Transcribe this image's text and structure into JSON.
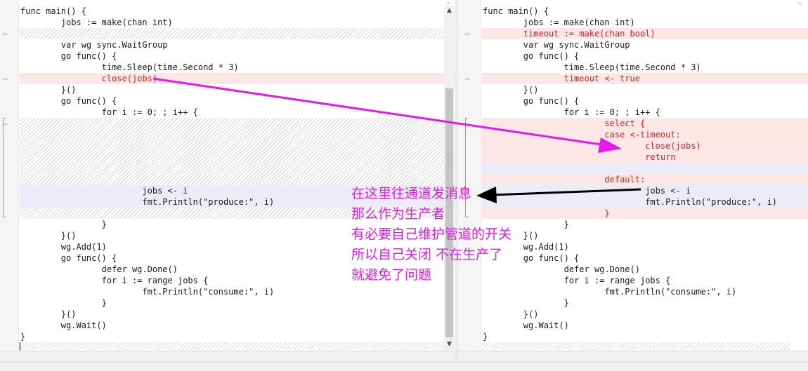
{
  "left": {
    "lines": [
      {
        "text": "func main() {",
        "type": "normal"
      },
      {
        "text": "        jobs := make(chan int)",
        "type": "normal"
      },
      {
        "text": "",
        "type": "filler"
      },
      {
        "text": "        var wg sync.WaitGroup",
        "type": "normal"
      },
      {
        "text": "        go func() {",
        "type": "normal"
      },
      {
        "text": "                time.Sleep(time.Second * 3)",
        "type": "normal"
      },
      {
        "text": "                close(jobs)",
        "type": "removed"
      },
      {
        "text": "        }()",
        "type": "normal"
      },
      {
        "text": "        go func() {",
        "type": "normal"
      },
      {
        "text": "                for i := 0; ; i++ {",
        "type": "normal"
      },
      {
        "text": "",
        "type": "filler"
      },
      {
        "text": "",
        "type": "filler"
      },
      {
        "text": "",
        "type": "filler"
      },
      {
        "text": "",
        "type": "filler"
      },
      {
        "text": "",
        "type": "filler"
      },
      {
        "text": "",
        "type": "filler"
      },
      {
        "text": "                        jobs <- i",
        "type": "changed"
      },
      {
        "text": "                        fmt.Println(\"produce:\", i)",
        "type": "changed"
      },
      {
        "text": "",
        "type": "filler"
      },
      {
        "text": "                }",
        "type": "normal"
      },
      {
        "text": "        }()",
        "type": "normal"
      },
      {
        "text": "        wg.Add(1)",
        "type": "normal"
      },
      {
        "text": "        go func() {",
        "type": "normal"
      },
      {
        "text": "                defer wg.Done()",
        "type": "normal"
      },
      {
        "text": "                for i := range jobs {",
        "type": "normal"
      },
      {
        "text": "                        fmt.Println(\"consume:\", i)",
        "type": "normal"
      },
      {
        "text": "                }",
        "type": "normal"
      },
      {
        "text": "        }()",
        "type": "normal"
      },
      {
        "text": "        wg.Wait()",
        "type": "normal"
      },
      {
        "text": "}",
        "type": "normal"
      }
    ]
  },
  "right": {
    "lines": [
      {
        "text": "func main() {",
        "type": "normal"
      },
      {
        "text": "        jobs := make(chan int)",
        "type": "normal"
      },
      {
        "text": "        timeout := make(chan bool)",
        "type": "added"
      },
      {
        "text": "        var wg sync.WaitGroup",
        "type": "normal"
      },
      {
        "text": "        go func() {",
        "type": "normal"
      },
      {
        "text": "                time.Sleep(time.Second * 3)",
        "type": "normal"
      },
      {
        "text": "                timeout <- true",
        "type": "added"
      },
      {
        "text": "        }()",
        "type": "normal"
      },
      {
        "text": "        go func() {",
        "type": "normal"
      },
      {
        "text": "                for i := 0; ; i++ {",
        "type": "normal"
      },
      {
        "text": "                        select {",
        "type": "added"
      },
      {
        "text": "                        case <-timeout:",
        "type": "added"
      },
      {
        "text": "                                close(jobs)",
        "type": "added"
      },
      {
        "text": "                                return",
        "type": "added"
      },
      {
        "text": "",
        "type": "blank-band"
      },
      {
        "text": "                        default:",
        "type": "added"
      },
      {
        "text": "                                jobs <- i",
        "type": "changed"
      },
      {
        "text": "                                fmt.Println(\"produce:\", i)",
        "type": "changed"
      },
      {
        "text": "                        }",
        "type": "added"
      },
      {
        "text": "                }",
        "type": "normal"
      },
      {
        "text": "        }()",
        "type": "normal"
      },
      {
        "text": "        wg.Add(1)",
        "type": "normal"
      },
      {
        "text": "        go func() {",
        "type": "normal"
      },
      {
        "text": "                defer wg.Done()",
        "type": "normal"
      },
      {
        "text": "                for i := range jobs {",
        "type": "normal"
      },
      {
        "text": "                        fmt.Println(\"consume:\", i)",
        "type": "normal"
      },
      {
        "text": "                }",
        "type": "normal"
      },
      {
        "text": "        }()",
        "type": "normal"
      },
      {
        "text": "        wg.Wait()",
        "type": "normal"
      },
      {
        "text": "}",
        "type": "normal"
      }
    ]
  },
  "annotation": {
    "lines": [
      "在这里往通道发消息",
      "那么作为生产者",
      "有必要自己维护管道的开关",
      "所以自己关闭 不在生产了",
      "就避免了问题"
    ]
  },
  "icons": {
    "diff_marker": "arrow-left-icon",
    "scroll_up": "scroll-up-arrow-icon",
    "scroll_down": "scroll-down-arrow-icon"
  },
  "colors": {
    "annotation": "#e61ae6",
    "removed_text": "#e02020",
    "diff_bg": "#fde6e6",
    "changed_bg": "#ececf9",
    "marker": "#d9a400"
  }
}
